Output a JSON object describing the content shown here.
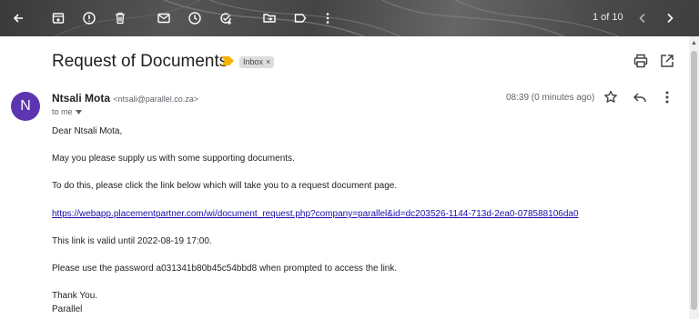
{
  "toolbar": {
    "icons": [
      "back-arrow-icon",
      "archive-icon",
      "report-spam-icon",
      "delete-icon",
      "mark-unread-icon",
      "snooze-icon",
      "add-to-tasks-icon",
      "move-to-icon",
      "label-icon",
      "more-icon"
    ],
    "pager": "1 of 10"
  },
  "email": {
    "subject": "Request of Documents",
    "label": "Inbox",
    "label_remove": "×",
    "avatar_letter": "N",
    "sender_name": "Ntsali Mota",
    "sender_email": "<ntsali@parallel.co.za>",
    "to": "to me",
    "time": "08:39 (0 minutes ago)",
    "body": [
      "Dear Ntsali Mota,",
      "May you please supply us with some supporting documents.",
      "To do this, please click the link below which will take you to a request document page.",
      "https://webapp.placementpartner.com/wi/document_request.php?company=parallel&id=dc203526-1144-713d-2ea0-078588106da0",
      "This link is valid until 2022-08-19 17:00.",
      "Please use the password a031341b80b45c54bbd8 when prompted to access the link.",
      "Thank You.",
      "Parallel"
    ]
  },
  "colors": {
    "avatar": "#5e35b1",
    "importance": "#f4b400",
    "link": "#1a0dab"
  }
}
